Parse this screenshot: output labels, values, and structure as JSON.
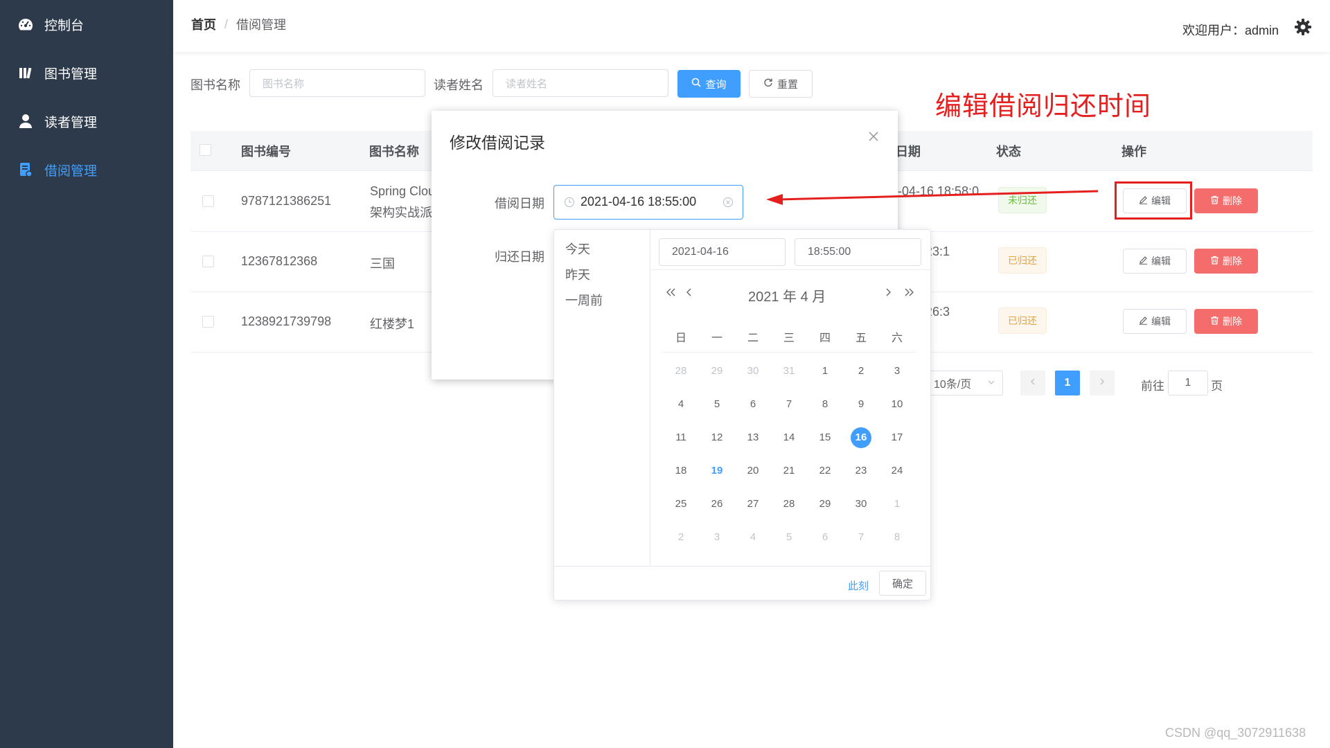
{
  "sidebar": {
    "items": [
      {
        "label": "控制台",
        "icon": "dashboard-icon"
      },
      {
        "label": "图书管理",
        "icon": "books-icon"
      },
      {
        "label": "读者管理",
        "icon": "user-icon"
      },
      {
        "label": "借阅管理",
        "icon": "borrow-icon",
        "active": true
      }
    ]
  },
  "header": {
    "breadcrumb_home": "首页",
    "breadcrumb_sep": "/",
    "breadcrumb_current": "借阅管理",
    "welcome": "欢迎用户：admin"
  },
  "search": {
    "book_label": "图书名称",
    "book_placeholder": "图书名称",
    "reader_label": "读者姓名",
    "reader_placeholder": "读者姓名",
    "query_button": "查询",
    "reset_button": "重置"
  },
  "annotation": "编辑借阅归还时间",
  "table": {
    "headers": [
      "图书编号",
      "图书名称",
      "日期",
      "状态",
      "操作"
    ],
    "rows": [
      {
        "id": "9787121386251",
        "name1": "Spring Clou",
        "name2": "架构实战派",
        "date": "-04-16 18:58:0",
        "status": "未归还",
        "status_type": "success"
      },
      {
        "id": "12367812368",
        "name1": "三国",
        "name2": "",
        "date": "5 19:23:1",
        "status": "已归还",
        "status_type": "warning"
      },
      {
        "id": "1238921739798",
        "name1": "红楼梦1",
        "name2": "",
        "date": "5 19:26:3",
        "status": "已归还",
        "status_type": "warning"
      }
    ],
    "edit_label": "编辑",
    "delete_label": "删除"
  },
  "pagination": {
    "page_size": "10条/页",
    "current_page": "1",
    "goto_label": "前往",
    "goto_value": "1",
    "page_suffix": "页"
  },
  "dialog": {
    "title": "修改借阅记录",
    "borrow_label": "借阅日期",
    "borrow_value": "2021-04-16 18:55:00",
    "return_label": "归还日期"
  },
  "picker": {
    "shortcuts": [
      "今天",
      "昨天",
      "一周前"
    ],
    "date_value": "2021-04-16",
    "time_value": "18:55:00",
    "title": "2021 年  4 月",
    "weekdays": [
      "日",
      "一",
      "二",
      "三",
      "四",
      "五",
      "六"
    ],
    "weeks": [
      [
        "28",
        "29",
        "30",
        "31",
        "1",
        "2",
        "3"
      ],
      [
        "4",
        "5",
        "6",
        "7",
        "8",
        "9",
        "10"
      ],
      [
        "11",
        "12",
        "13",
        "14",
        "15",
        "16",
        "17"
      ],
      [
        "18",
        "19",
        "20",
        "21",
        "22",
        "23",
        "24"
      ],
      [
        "25",
        "26",
        "27",
        "28",
        "29",
        "30",
        "1"
      ],
      [
        "2",
        "3",
        "4",
        "5",
        "6",
        "7",
        "8"
      ]
    ],
    "selected": "16",
    "today": "19",
    "now_label": "此刻",
    "ok_label": "确定"
  },
  "watermark": "CSDN @qq_3072911638",
  "colors": {
    "sidebar_bg": "#2d3a4b",
    "primary": "#409eff",
    "danger": "#f56c6c",
    "annotation": "#e51e1e"
  }
}
